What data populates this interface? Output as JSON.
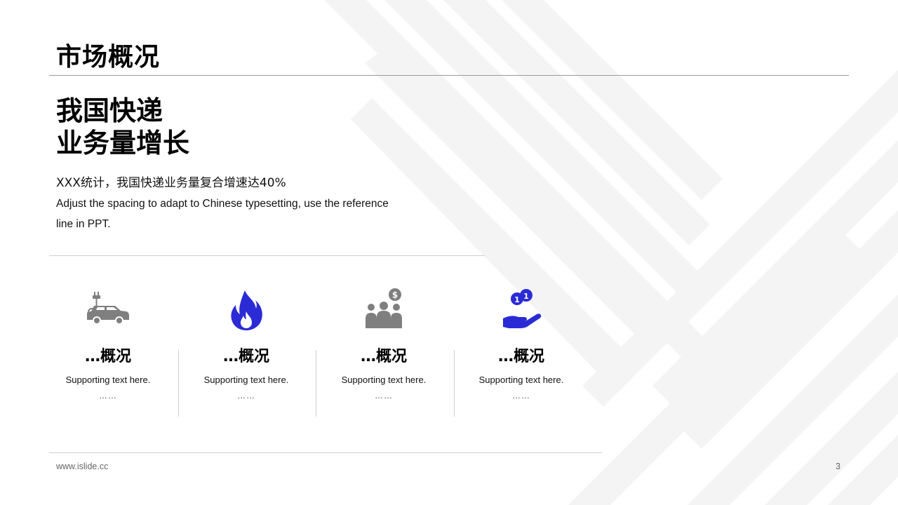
{
  "slide": {
    "title": "市场概况",
    "headline_lines": [
      "我国快递",
      "业务量增长"
    ],
    "stat_text": "XXX统计，我国快递业务量复合增速达40%",
    "description": "Adjust the spacing to adapt to Chinese typesetting, use the reference line in PPT."
  },
  "cards": [
    {
      "icon": "electric-car-icon",
      "icon_color": "#7f7f7f",
      "title": "…概况",
      "subtitle": "Supporting  text here.",
      "dots": "……"
    },
    {
      "icon": "flame-icon",
      "icon_color": "#2b2bd6",
      "title": "…概况",
      "subtitle": "Supporting  text here.",
      "dots": "……"
    },
    {
      "icon": "people-money-icon",
      "icon_color": "#7f7f7f",
      "title": "…概况",
      "subtitle": "Supporting  text here.",
      "dots": "……"
    },
    {
      "icon": "hand-coins-icon",
      "icon_color": "#2b2bd6",
      "title": "…概况",
      "subtitle": "Supporting  text here.",
      "dots": "……"
    }
  ],
  "footer": {
    "url": "www.islide.cc",
    "page_number": "3"
  },
  "colors": {
    "accent_blue": "#2b2bd6",
    "icon_gray": "#7f7f7f",
    "stripe": "#f3f3f3"
  }
}
